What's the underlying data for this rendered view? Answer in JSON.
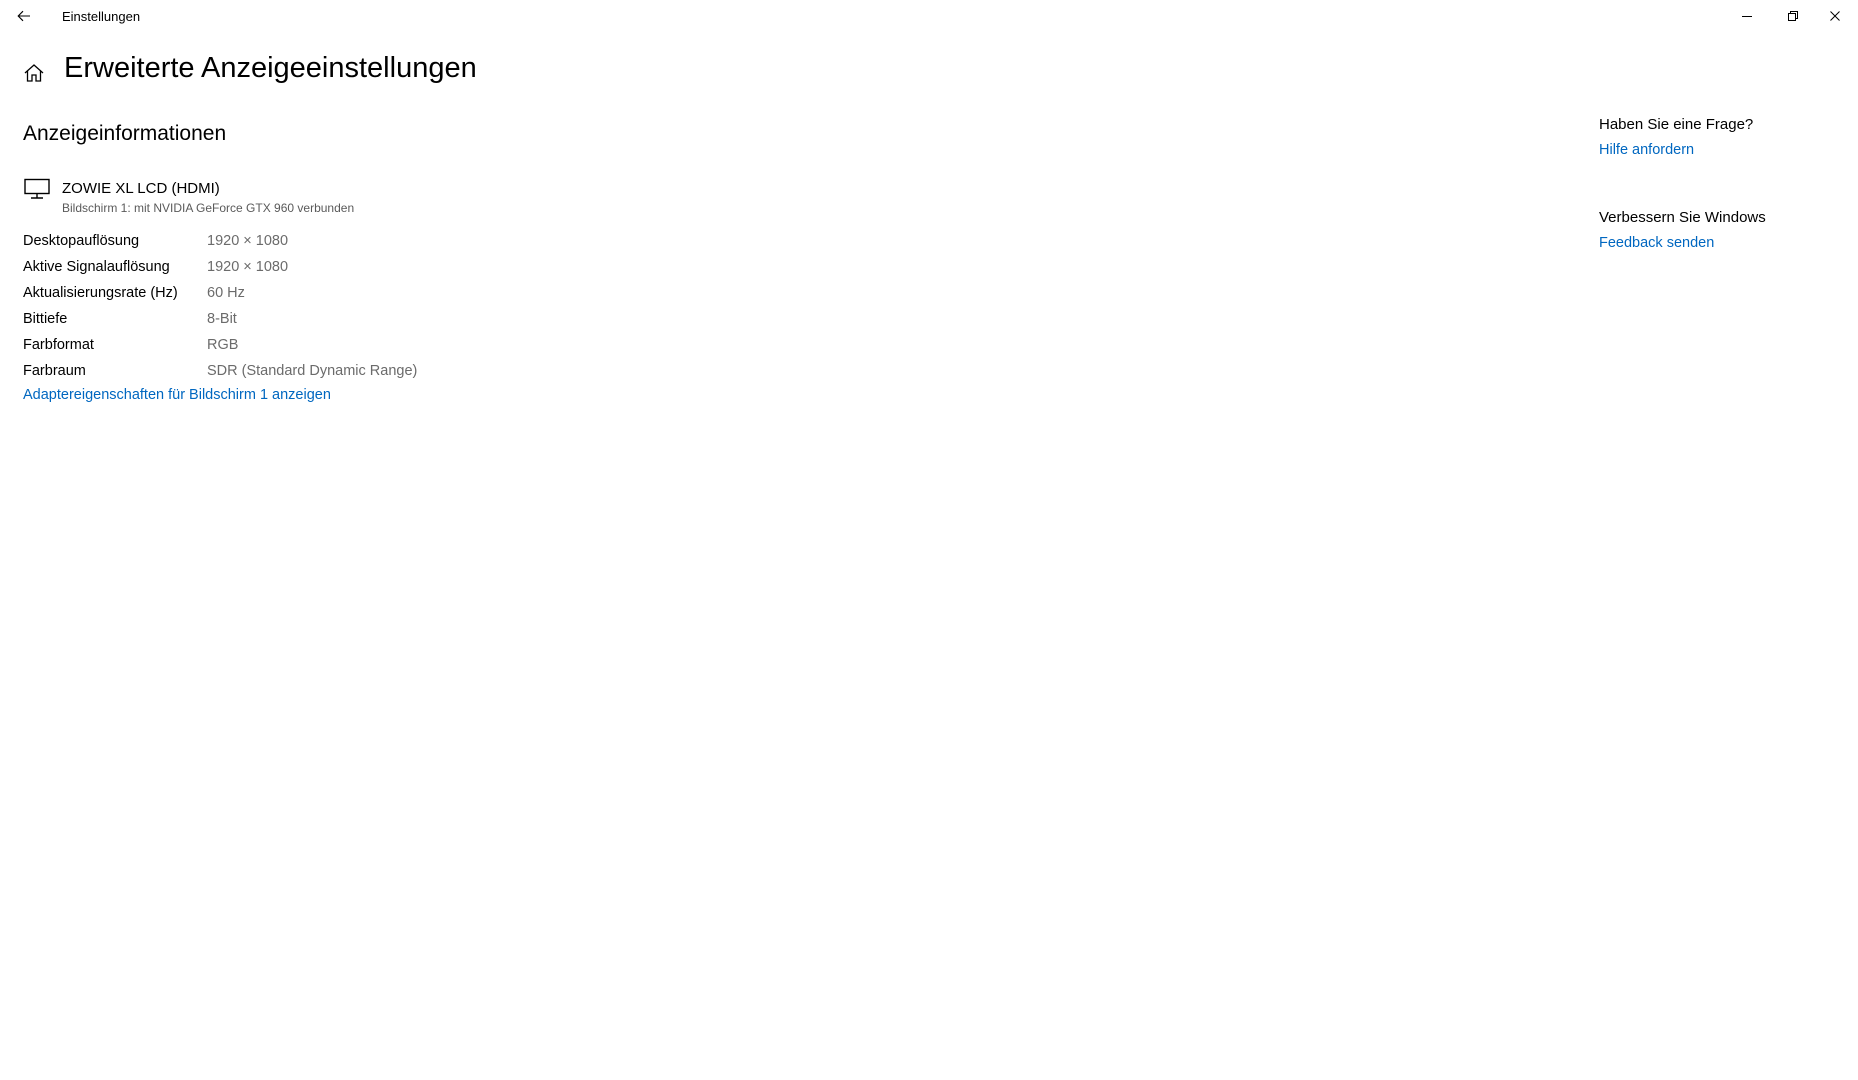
{
  "window": {
    "app_title": "Einstellungen"
  },
  "header": {
    "title": "Erweiterte Anzeigeeinstellungen"
  },
  "section": {
    "title": "Anzeigeinformationen",
    "monitor": {
      "name": "ZOWIE XL LCD (HDMI)",
      "subtitle": "Bildschirm 1: mit NVIDIA GeForce GTX 960 verbunden"
    },
    "rows": [
      {
        "label": "Desktopauflösung",
        "value": "1920 × 1080"
      },
      {
        "label": "Aktive Signalauflösung",
        "value": "1920 × 1080"
      },
      {
        "label": "Aktualisierungsrate (Hz)",
        "value": "60 Hz"
      },
      {
        "label": "Bittiefe",
        "value": "8-Bit"
      },
      {
        "label": "Farbformat",
        "value": "RGB"
      },
      {
        "label": "Farbraum",
        "value": "SDR (Standard Dynamic Range)"
      }
    ],
    "adapter_link": "Adaptereigenschaften für Bildschirm 1 anzeigen"
  },
  "right_panel": {
    "question_heading": "Haben Sie eine Frage?",
    "help_link": "Hilfe anfordern",
    "improve_heading": "Verbessern Sie Windows",
    "feedback_link": "Feedback senden"
  },
  "icons": {
    "back": "back-arrow-icon",
    "home": "home-icon",
    "monitor": "monitor-icon",
    "minimize": "minimize-icon",
    "restore": "restore-icon",
    "close": "close-icon"
  },
  "colors": {
    "link": "#0067c0",
    "value_text": "#6b6b6b",
    "background": "#ffffff"
  }
}
